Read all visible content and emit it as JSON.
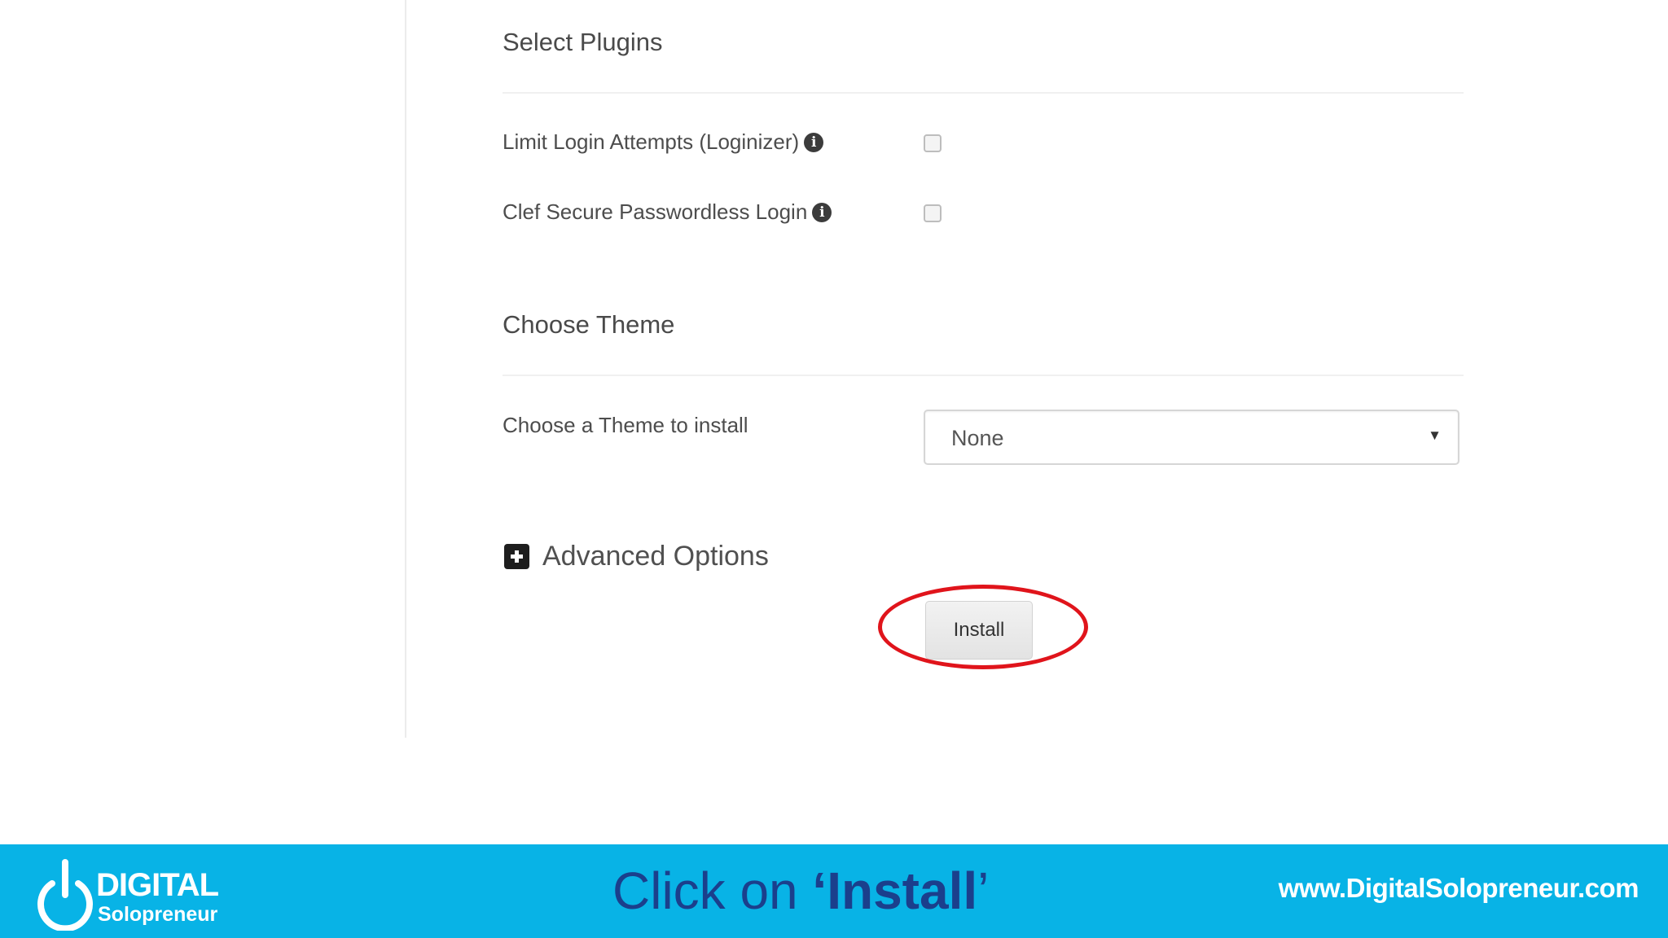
{
  "plugins": {
    "heading": "Select Plugins",
    "items": [
      {
        "label": "Limit Login Attempts (Loginizer)",
        "checked": false
      },
      {
        "label": "Clef Secure Passwordless Login",
        "checked": false
      }
    ]
  },
  "theme": {
    "heading": "Choose Theme",
    "label": "Choose a Theme to install",
    "selected": "None"
  },
  "advanced": {
    "label": "Advanced Options"
  },
  "install_button": {
    "label": "Install"
  },
  "footer": {
    "logo_top": "DIGITAL",
    "logo_bottom": "Solopreneur",
    "caption_pre": "Click on ",
    "caption_open_quote": "‘",
    "caption_bold": "Install",
    "caption_close_quote": "’",
    "url": "www.DigitalSolopreneur.com"
  },
  "colors": {
    "banner": "#08b3e6",
    "caption": "#1b3f8c",
    "highlight": "#e0141b"
  }
}
